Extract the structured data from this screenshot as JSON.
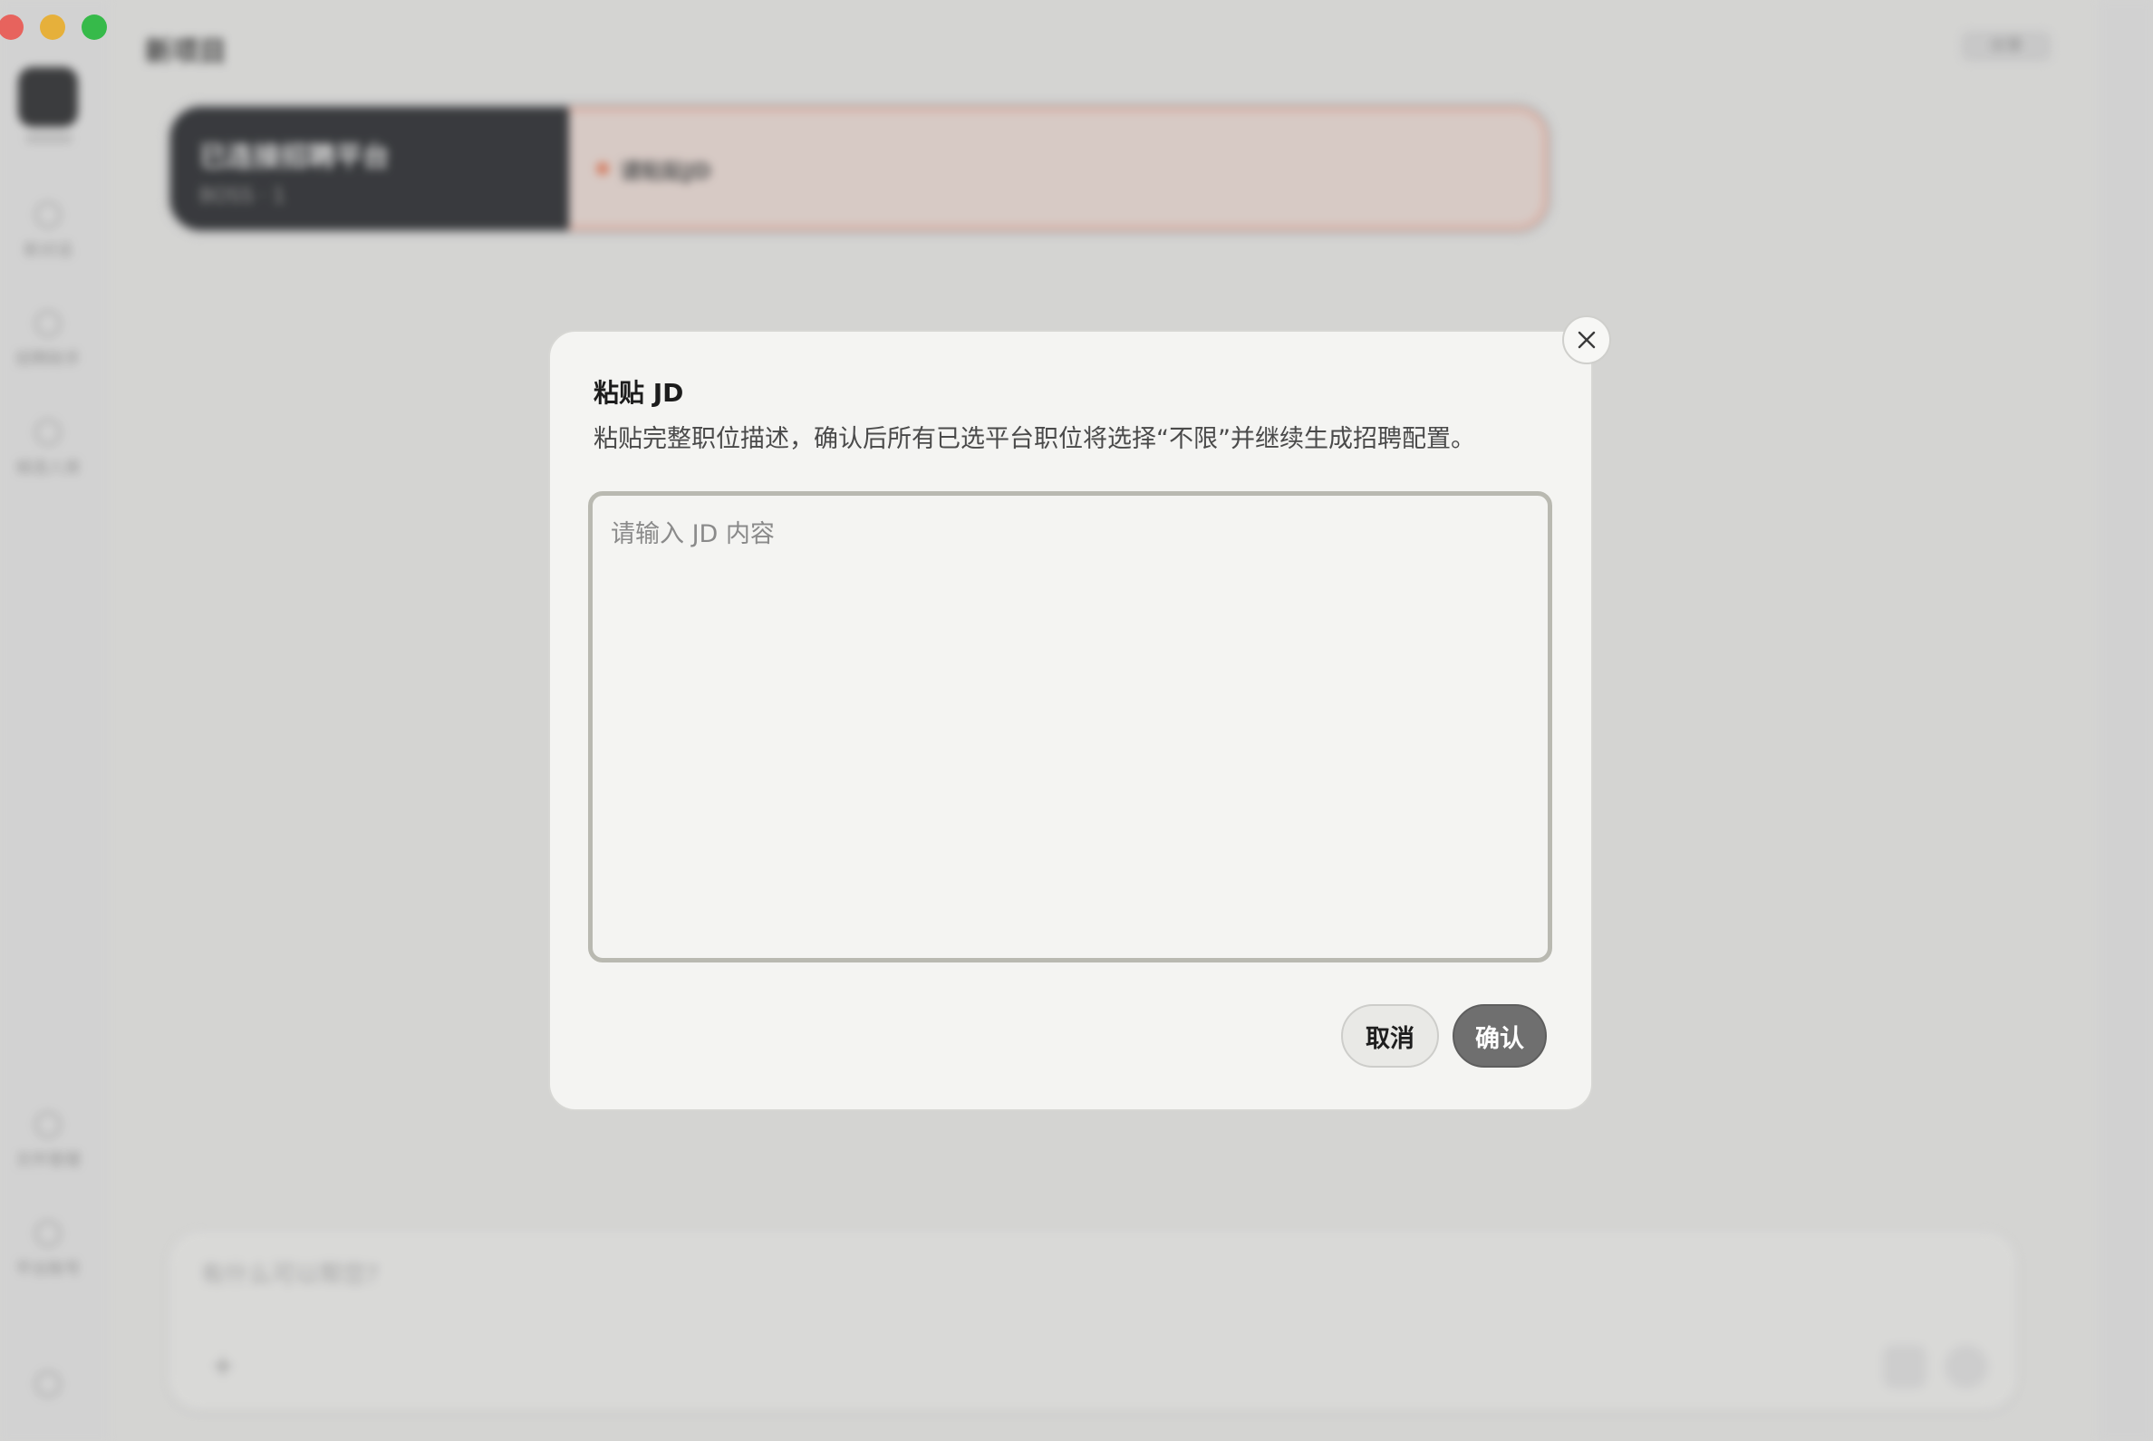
{
  "window": {
    "title": "新项目",
    "header_right_label": "分享"
  },
  "sidebar": {
    "items": [
      {
        "label": "新对话",
        "icon": "play-icon"
      },
      {
        "label": "招聘助手",
        "icon": "circle-icon"
      },
      {
        "label": "候选人库",
        "icon": "circle-icon"
      }
    ],
    "bottom_items": [
      {
        "label": "文件管理",
        "icon": "circle-icon"
      },
      {
        "label": "平台账号",
        "icon": "circle-icon"
      }
    ]
  },
  "banner": {
    "left_title": "已连接招聘平台",
    "left_sub": "BOSS · 1",
    "right_text": "请粘贴JD"
  },
  "composer": {
    "placeholder": "有什么可以帮您?",
    "add_label": "+"
  },
  "modal": {
    "title": "粘贴 JD",
    "description": "粘贴完整职位描述，确认后所有已选平台职位将选择“不限”并继续生成招聘配置。",
    "input_placeholder": "请输入 JD 内容",
    "input_value": "",
    "cancel_label": "取消",
    "confirm_label": "确认"
  },
  "colors": {
    "confirm_bg": "#6f6f6f",
    "input_border": "#b9b9b1",
    "banner_accent": "#f1b8a8"
  }
}
